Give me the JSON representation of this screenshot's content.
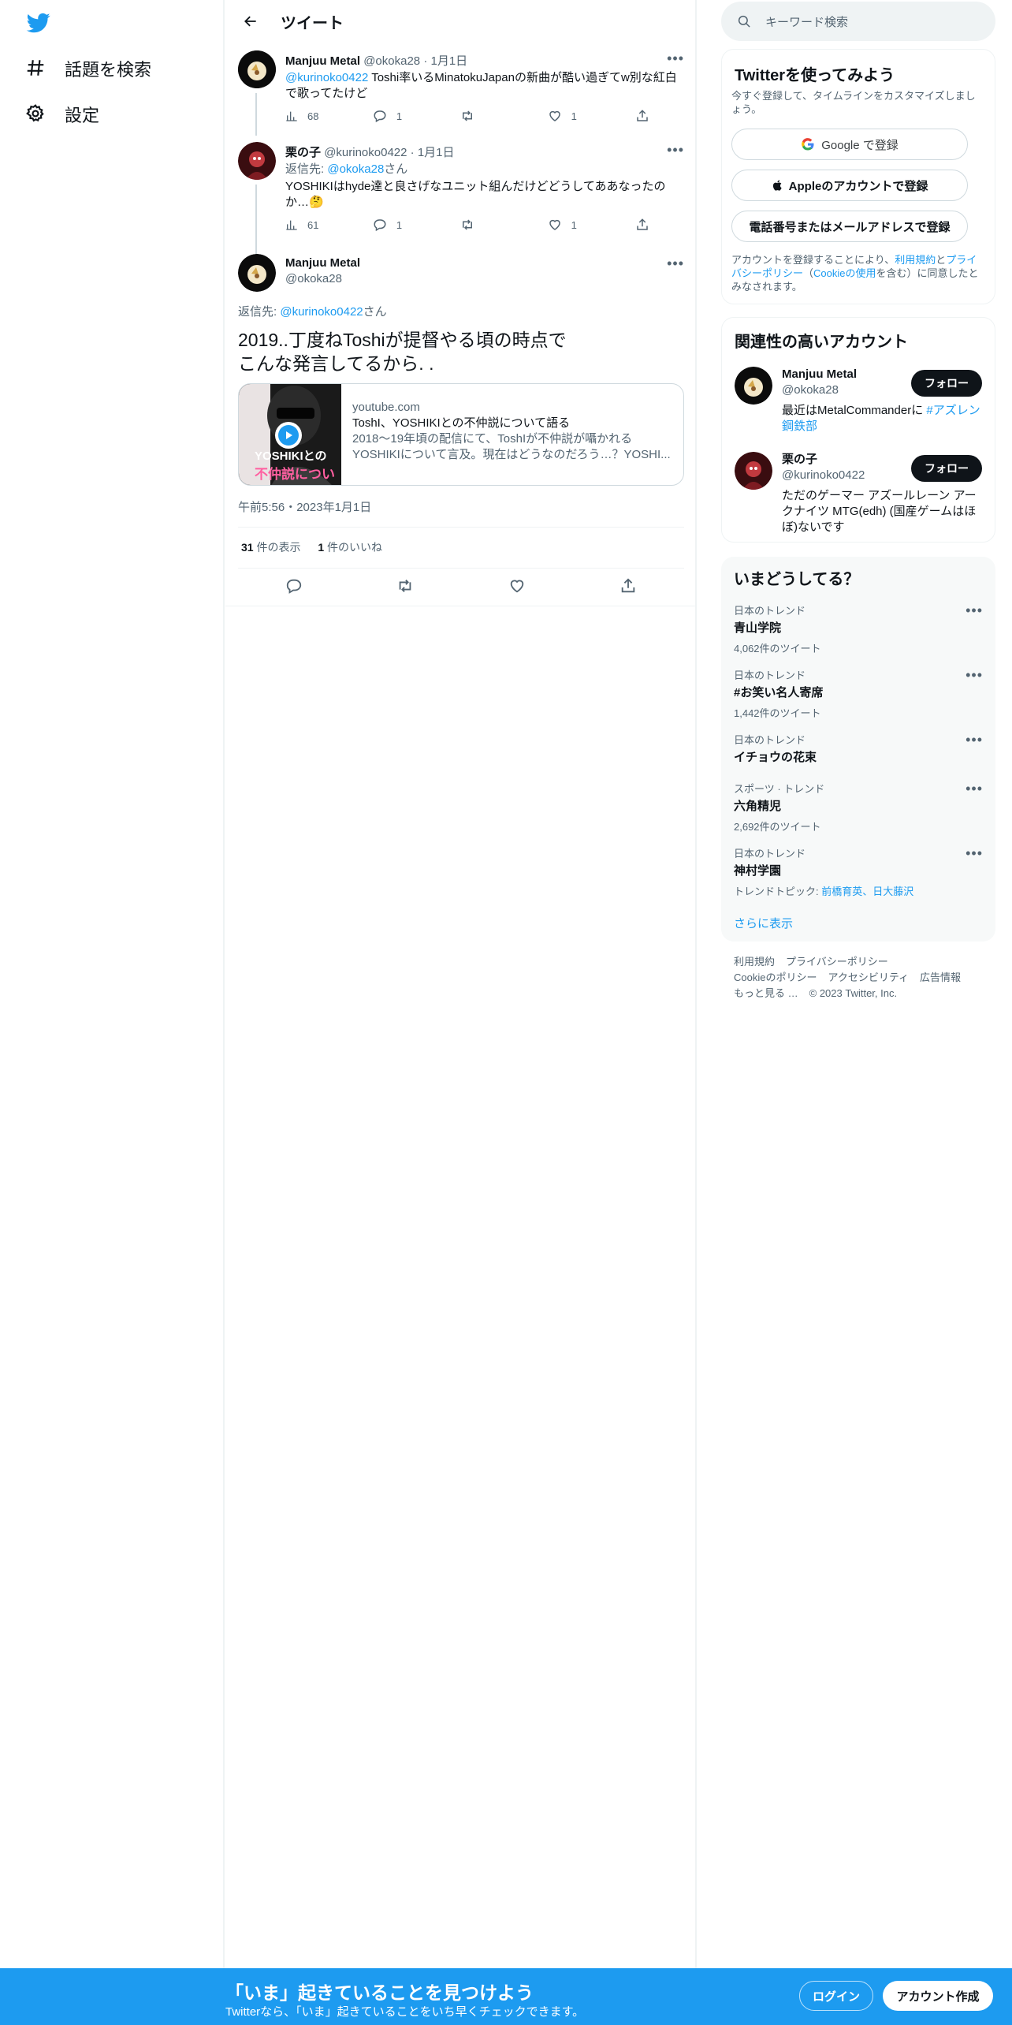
{
  "nav": {
    "explore_label": "話題を検索",
    "settings_label": "設定"
  },
  "header": {
    "title": "ツイート"
  },
  "tweets": [
    {
      "name": "Manjuu Metal",
      "handle": "@okoka28",
      "date": "1月1日",
      "mention": "@kurinoko0422",
      "text": " Toshi率いるMinatokuJapanの新曲が酷い過ぎてw別な紅白で歌ってたけど",
      "views": "68",
      "replies": "1",
      "retweets": "",
      "likes": "1"
    },
    {
      "name": "栗の子",
      "handle": "@kurinoko0422",
      "date": "1月1日",
      "reply_prefix": "返信先: ",
      "reply_to": "@okoka28",
      "reply_suffix": "さん",
      "text": "YOSHIKIはhyde達と良さげなユニット組んだけどどうしてああなったのか…🤔",
      "views": "61",
      "replies": "1",
      "retweets": "",
      "likes": "1"
    }
  ],
  "focus": {
    "name": "Manjuu Metal",
    "handle": "@okoka28",
    "reply_prefix": "返信先: ",
    "reply_to": "@kurinoko0422",
    "reply_suffix": "さん",
    "text_line1": "2019..丁度ねToshiが提督やる頃の時点で",
    "text_line2": "こんな発言してるから. .",
    "card": {
      "domain": "youtube.com",
      "title": "ToshI、YOSHIKIとの不仲説について語る",
      "desc_line1": "2018〜19年頃の配信にて、ToshIが不仲説が囁かれる",
      "desc_line2": "YOSHIKIについて言及。現在はどうなのだろう…？YOSHI...",
      "thumb_text1": "YOSHIKIとの",
      "thumb_text2": "不仲説について"
    },
    "timestamp": "午前5:56・2023年1月1日",
    "views_count": "31",
    "views_label": " 件の表示",
    "likes_count": "1",
    "likes_label": " 件のいいね"
  },
  "search": {
    "placeholder": "キーワード検索"
  },
  "signup": {
    "title": "Twitterを使ってみよう",
    "subtitle": "今すぐ登録して、タイムラインをカスタマイズしましょう。",
    "google": "Google で登録",
    "apple": "Appleのアカウントで登録",
    "phone": "電話番号またはメールアドレスで登録",
    "legal_pre": "アカウントを登録することにより、",
    "legal_terms": "利用規約",
    "legal_mid": "と",
    "legal_privacy": "プライバシーポリシー",
    "legal_mid2": "（",
    "legal_cookie": "Cookieの使用",
    "legal_post": "を含む）に同意したとみなされます。"
  },
  "related": {
    "title": "関連性の高いアカウント",
    "accounts": [
      {
        "name": "Manjuu Metal",
        "handle": "@okoka28",
        "bio": "最近はMetalCommanderに ",
        "bio_link": "#アズレン鋼鉄部",
        "follow": "フォロー"
      },
      {
        "name": "栗の子",
        "handle": "@kurinoko0422",
        "bio": "ただのゲーマー アズールレーン アークナイツ MTG(edh) (国産ゲームはほぼ)ないです",
        "follow": "フォロー"
      }
    ]
  },
  "trends": {
    "title": "いまどうしてる？",
    "items": [
      {
        "category": "日本のトレンド",
        "name": "青山学院",
        "count": "4,062件のツイート"
      },
      {
        "category": "日本のトレンド",
        "name": "#お笑い名人寄席",
        "count": "1,442件のツイート"
      },
      {
        "category": "日本のトレンド",
        "name": "イチョウの花束",
        "count": ""
      },
      {
        "category": "スポーツ · トレンド",
        "name": "六角精児",
        "count": "2,692件のツイート"
      },
      {
        "category": "日本のトレンド",
        "name": "神村学園",
        "topic_label": "トレンドトピック: ",
        "topic_links": "前橋育英、日大藤沢"
      }
    ],
    "show_more": "さらに表示"
  },
  "footer": {
    "terms": "利用規約",
    "privacy": "プライバシーポリシー",
    "cookie": "Cookieのポリシー",
    "accessibility": "アクセシビリティ",
    "ads": "広告情報",
    "more": "もっと見る …",
    "copyright": "© 2023 Twitter, Inc."
  },
  "bottom_bar": {
    "title": "「いま」起きていることを見つけよう",
    "subtitle": "Twitterなら、「いま」起きていることをいち早くチェックできます。",
    "login": "ログイン",
    "signup": "アカウント作成"
  },
  "colors": {
    "brand": "#1d9bf0",
    "text": "#0f1419",
    "muted": "#536471"
  }
}
